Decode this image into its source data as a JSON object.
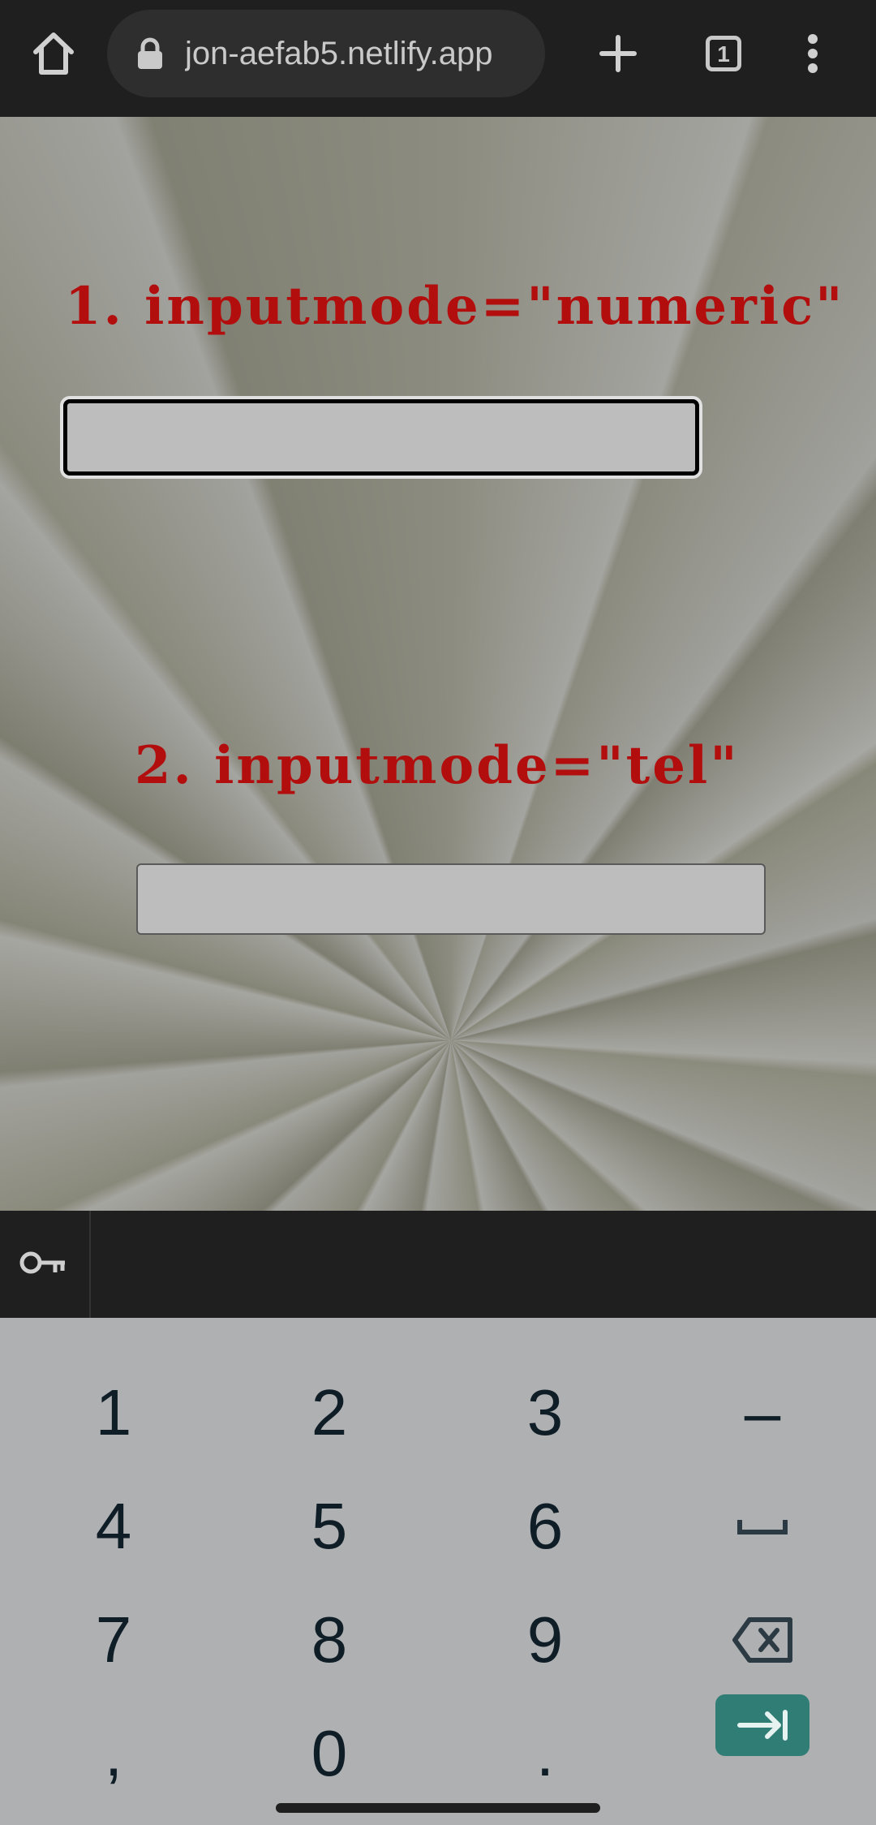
{
  "browser": {
    "url": "jon-aefab5.netlify.app",
    "tab_count": "1",
    "icons": [
      "home-icon",
      "lock-icon",
      "plus-icon",
      "tab-switcher-icon",
      "more-vert-icon"
    ]
  },
  "page": {
    "sections": [
      {
        "heading": "1. inputmode=\"numeric\"",
        "input_value": ""
      },
      {
        "heading": "2. inputmode=\"tel\"",
        "input_value": ""
      }
    ],
    "colors": {
      "heading": "#b30e0e",
      "input_bg": "#bdbdbd"
    }
  },
  "keyboard": {
    "toolbar_icon": "key-icon",
    "rows": [
      [
        "1",
        "2",
        "3",
        "–"
      ],
      [
        "4",
        "5",
        "6",
        "space"
      ],
      [
        "7",
        "8",
        "9",
        "backspace"
      ],
      [
        ",",
        "0",
        ".",
        "next"
      ]
    ],
    "keys": {
      "k1": "1",
      "k2": "2",
      "k3": "3",
      "dash": "–",
      "k4": "4",
      "k5": "5",
      "k6": "6",
      "k7": "7",
      "k8": "8",
      "k9": "9",
      "comma": ",",
      "k0": "0",
      "period": "."
    },
    "enter_color": "#2f7d74"
  }
}
